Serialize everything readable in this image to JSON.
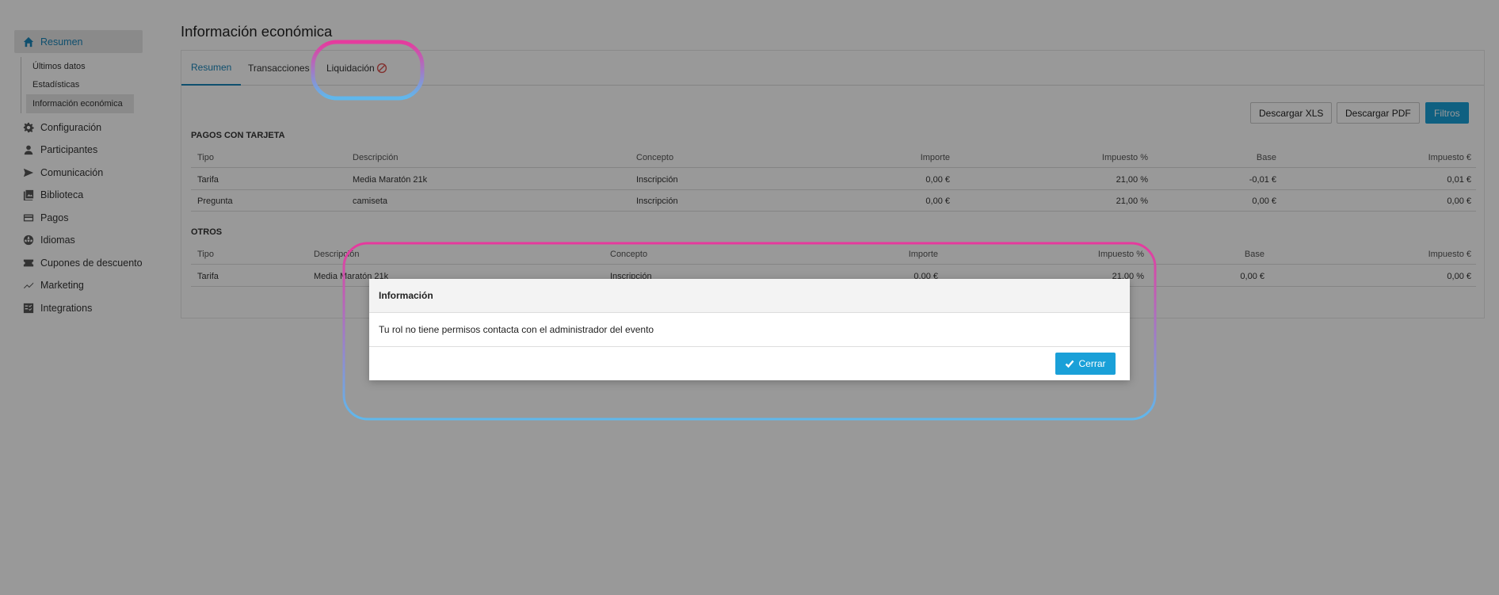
{
  "sidebar": {
    "items": [
      {
        "label": "Resumen",
        "icon": "home-icon",
        "active": true
      },
      {
        "label": "Configuración",
        "icon": "gear-icon"
      },
      {
        "label": "Participantes",
        "icon": "user-icon"
      },
      {
        "label": "Comunicación",
        "icon": "send-icon"
      },
      {
        "label": "Biblioteca",
        "icon": "library-icon"
      },
      {
        "label": "Pagos",
        "icon": "card-icon"
      },
      {
        "label": "Idiomas",
        "icon": "globe-icon"
      },
      {
        "label": "Cupones de descuento",
        "icon": "coupon-icon"
      },
      {
        "label": "Marketing",
        "icon": "chart-line-icon"
      },
      {
        "label": "Integrations",
        "icon": "integrations-icon"
      }
    ],
    "subitems": [
      {
        "label": "Últimos datos"
      },
      {
        "label": "Estadísticas"
      },
      {
        "label": "Información económica",
        "active": true
      }
    ]
  },
  "main": {
    "title": "Información económica",
    "tabs": [
      {
        "label": "Resumen",
        "active": true
      },
      {
        "label": "Transacciones"
      },
      {
        "label": "Liquidación",
        "icon": "ban-icon"
      }
    ],
    "buttons": {
      "xls": "Descargar XLS",
      "pdf": "Descargar PDF",
      "filters": "Filtros"
    },
    "card_section": {
      "title": "PAGOS CON TARJETA",
      "headers": [
        "Tipo",
        "Descripción",
        "Concepto",
        "Importe",
        "Impuesto %",
        "Base",
        "Impuesto €"
      ],
      "rows": [
        [
          "Tarifa",
          "Media Maratón 21k",
          "Inscripción",
          "0,00 €",
          "21,00 %",
          "-0,01 €",
          "0,01 €"
        ],
        [
          "Pregunta",
          "camiseta",
          "Inscripción",
          "0,00 €",
          "21,00 %",
          "0,00 €",
          "0,00 €"
        ]
      ]
    },
    "other_section": {
      "title": "OTROS",
      "headers": [
        "Tipo",
        "Descripción",
        "Concepto",
        "Importe",
        "Impuesto %",
        "Base",
        "Impuesto €"
      ],
      "rows": [
        [
          "Tarifa",
          "Media Maratón 21k",
          "Inscripción",
          "0,00 €",
          "21,00 %",
          "0,00 €",
          "0,00 €"
        ]
      ]
    }
  },
  "modal": {
    "title": "Información",
    "message": "Tu rol no tiene permisos contacta con el administrador del evento",
    "close_label": "Cerrar"
  },
  "colors": {
    "accent": "#1aa0d8",
    "highlight_top": "#e63a9d",
    "highlight_bottom": "#5fb8ec"
  }
}
